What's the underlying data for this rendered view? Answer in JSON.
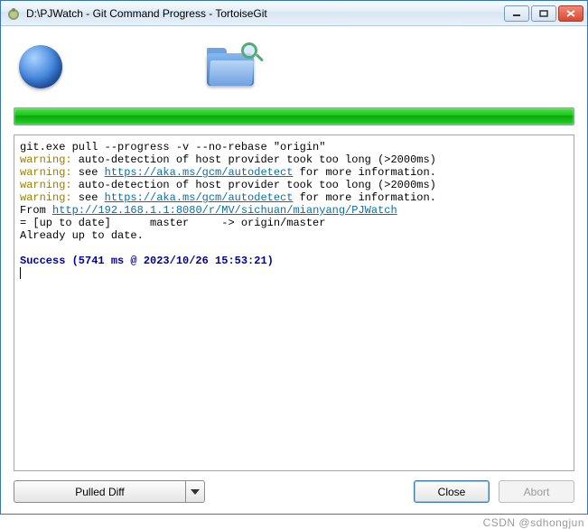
{
  "window": {
    "title": "D:\\PJWatch - Git Command Progress - TortoiseGit"
  },
  "output": {
    "line1": "git.exe pull --progress -v --no-rebase \"origin\"",
    "warn_label": "warning:",
    "warn1_text": " auto-detection of host provider took too long (>2000ms)",
    "warn2_pre": " see ",
    "warn2_link": "https://aka.ms/gcm/autodetect",
    "warn2_post": " for more information.",
    "warn3_text": " auto-detection of host provider took too long (>2000ms)",
    "warn4_pre": " see ",
    "warn4_link": "https://aka.ms/gcm/autodetect",
    "warn4_post": " for more information.",
    "from_label": "From ",
    "from_link": "http://192.168.1.1:8080/r/MV/sichuan/mianyang/PJWatch",
    "branch_line": "= [up to date]      master     -> origin/master",
    "already": "Already up to date.",
    "success": "Success (5741 ms @ 2023/10/26 15:53:21)"
  },
  "footer": {
    "pulled_diff": "Pulled Diff",
    "close": "Close",
    "abort": "Abort"
  },
  "watermark": "CSDN @sdhongjun"
}
